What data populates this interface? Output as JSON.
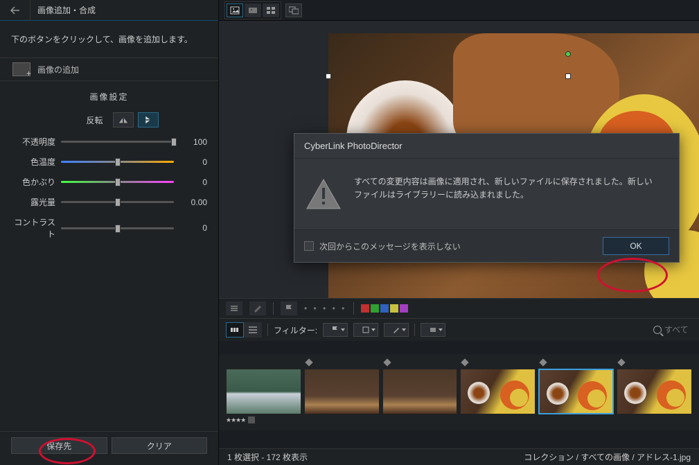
{
  "left_panel": {
    "title": "画像追加・合成",
    "instruction": "下のボタンをクリックして、画像を追加します。",
    "add_image_label": "画像の追加",
    "settings_title": "画像設定",
    "flip_label": "反転",
    "sliders": {
      "opacity": {
        "label": "不透明度",
        "value": "100",
        "pos": 100
      },
      "temp": {
        "label": "色温度",
        "value": "0",
        "pos": 50
      },
      "tint": {
        "label": "色かぶり",
        "value": "0",
        "pos": 50
      },
      "exposure": {
        "label": "露光量",
        "value": "0.00",
        "pos": 50
      },
      "contrast": {
        "label": "コントラスト",
        "value": "0",
        "pos": 50
      }
    },
    "save_btn": "保存先",
    "clear_btn": "クリア"
  },
  "filter_bar": {
    "label": "フィルター:",
    "search_placeholder": "すべて"
  },
  "thumb_rating": "★★★★",
  "tag_colors": [
    "#c03030",
    "#30a030",
    "#3060c0",
    "#c8c040",
    "#a040c0"
  ],
  "status": {
    "left": "1 枚選択 - 172 枚表示",
    "right": "コレクション / すべての画像 / アドレス-1.jpg"
  },
  "dialog": {
    "title": "CyberLink PhotoDirector",
    "msg1": "すべての変更内容は画像に適用され、新しいファイルに保存されました。新しい",
    "msg2": "ファイルはライブラリーに読み込まれました。",
    "checkbox_label": "次回からこのメッセージを表示しない",
    "ok": "OK"
  }
}
